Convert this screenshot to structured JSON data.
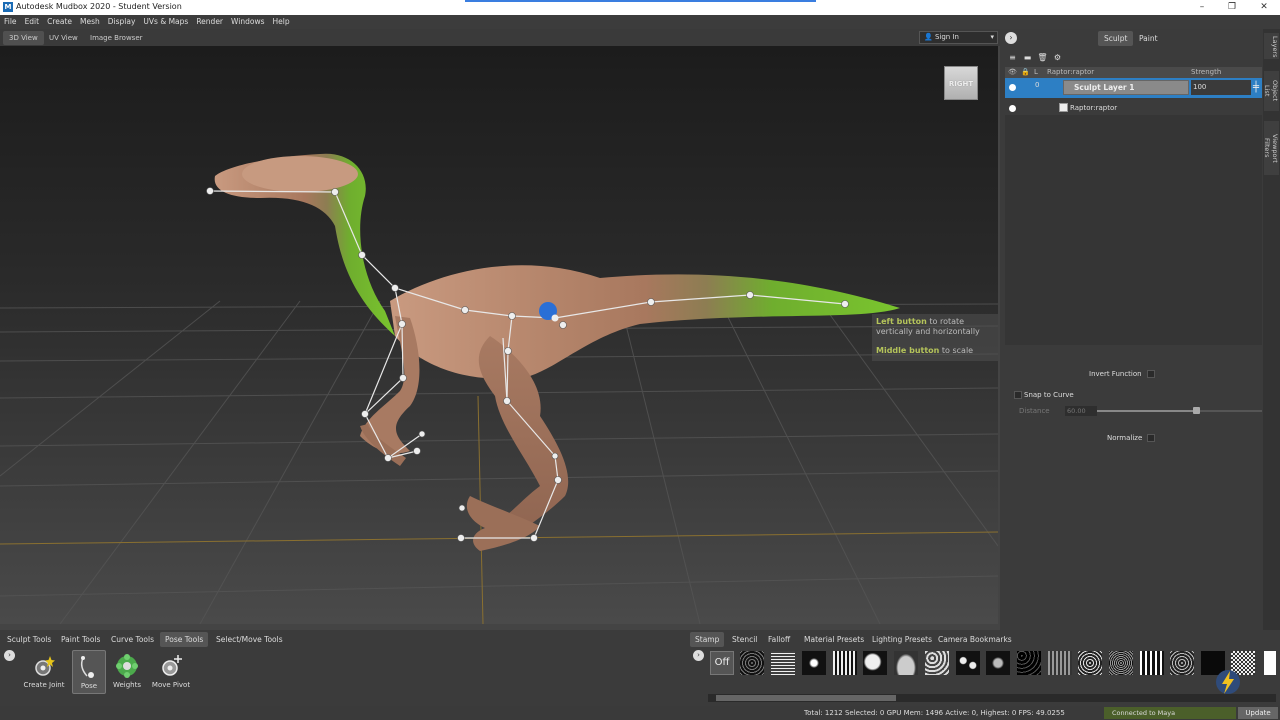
{
  "app": {
    "title": "Autodesk Mudbox 2020 - Student Version",
    "logo_letter": "M"
  },
  "window_buttons": [
    "–",
    "❐",
    "✕"
  ],
  "menu": [
    "File",
    "Edit",
    "Create",
    "Mesh",
    "Display",
    "UVs & Maps",
    "Render",
    "Windows",
    "Help"
  ],
  "view_tabs": [
    "3D View",
    "UV View",
    "Image Browser"
  ],
  "active_view_tab": "3D View",
  "sign_in": "Sign In",
  "viewcube_label": "RIGHT",
  "hint": {
    "line1_hl": "Left button",
    "line1_rest": " to rotate",
    "line2": "vertically and horizontally",
    "line3_hl": "Middle button",
    "line3_rest": " to scale"
  },
  "right_panel": {
    "tabs": [
      "Sculpt",
      "Paint"
    ],
    "active_tab": "Sculpt",
    "header": {
      "layer": "Raptor:raptor",
      "strength": "Strength",
      "lock_col": "L"
    },
    "layer_row": {
      "index": "0",
      "name": "Sculpt Layer 1",
      "strength": "100"
    },
    "mesh_row": {
      "name": "Raptor:raptor"
    },
    "side_tabs": [
      "Layers",
      "Object List",
      "Viewport Filters"
    ],
    "props": {
      "invert_function": "Invert Function",
      "snap_to_curve": "Snap to Curve",
      "distance_label": "Distance",
      "distance_value": "60.00",
      "normalize": "Normalize"
    }
  },
  "shelf_left": {
    "tabs": [
      "Sculpt Tools",
      "Paint Tools",
      "Curve Tools",
      "Pose Tools",
      "Select/Move Tools"
    ],
    "active_tab": "Pose Tools",
    "tools": [
      {
        "label": "Create Joint",
        "icon": "create-joint-icon"
      },
      {
        "label": "Pose",
        "icon": "pose-icon"
      },
      {
        "label": "Weights",
        "icon": "weights-icon"
      },
      {
        "label": "Move Pivot",
        "icon": "move-pivot-icon"
      }
    ],
    "active_tool": "Pose"
  },
  "shelf_right": {
    "tabs": [
      "Stamp",
      "Stencil",
      "Falloff",
      "Material Presets",
      "Lighting Presets",
      "Camera Bookmarks"
    ],
    "active_tab": "Stamp",
    "off_label": "Off"
  },
  "status": {
    "text": "Total: 1212  Selected: 0 GPU Mem: 1496  Active: 0, Highest: 0  FPS: 49.0255",
    "connected": "Connected to Maya",
    "update": "Update"
  },
  "colors": {
    "accent_blue": "#2d7fc4",
    "joint_blue": "#2a6fd6",
    "raptor_skin": "#b98a6e",
    "weight_green": "#6fbe2a",
    "hint_highlight": "#b4c35a"
  }
}
